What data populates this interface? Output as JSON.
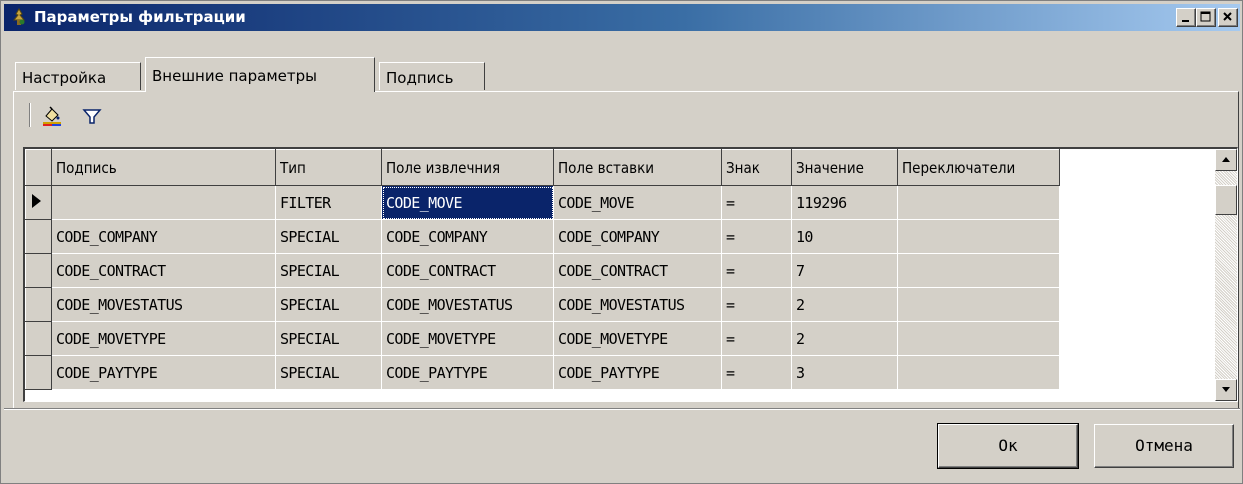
{
  "window": {
    "title": "Параметры фильтрации",
    "controls": {
      "minimize": "_",
      "maximize": "□",
      "close": "×"
    }
  },
  "tabs": [
    {
      "label": "Настройка",
      "active": false
    },
    {
      "label": "Внешние параметры",
      "active": true
    },
    {
      "label": "Подпись",
      "active": false
    }
  ],
  "toolbar": {
    "items": [
      {
        "icon": "paint-bucket-icon"
      },
      {
        "icon": "filter-icon"
      }
    ]
  },
  "grid": {
    "columns": [
      "Подпись",
      "Тип",
      "Поле извлечния",
      "Поле вставки",
      "Знак",
      "Значение",
      "Переключатели"
    ],
    "current_row_indicator": "▶",
    "rows": [
      [
        "",
        "FILTER",
        "CODE_MOVE",
        "CODE_MOVE",
        "=",
        "119296",
        ""
      ],
      [
        "CODE_COMPANY",
        "SPECIAL",
        "CODE_COMPANY",
        "CODE_COMPANY",
        "=",
        "10",
        ""
      ],
      [
        "CODE_CONTRACT",
        "SPECIAL",
        "CODE_CONTRACT",
        "CODE_CONTRACT",
        "=",
        "7",
        ""
      ],
      [
        "CODE_MOVESTATUS",
        "SPECIAL",
        "CODE_MOVESTATUS",
        "CODE_MOVESTATUS",
        "=",
        "2",
        ""
      ],
      [
        "CODE_MOVETYPE",
        "SPECIAL",
        "CODE_MOVETYPE",
        "CODE_MOVETYPE",
        "=",
        "2",
        ""
      ],
      [
        "CODE_PAYTYPE",
        "SPECIAL",
        "CODE_PAYTYPE",
        "CODE_PAYTYPE",
        "=",
        "3",
        ""
      ]
    ],
    "selected_row": 0,
    "selected_column": 2
  },
  "buttons": {
    "ok": "Ок",
    "cancel": "Отмена"
  },
  "colors": {
    "title_bar_start": "#0a246a",
    "title_bar_end": "#a6caf0",
    "face": "#d4d0c8",
    "selection": "#0a246a"
  }
}
